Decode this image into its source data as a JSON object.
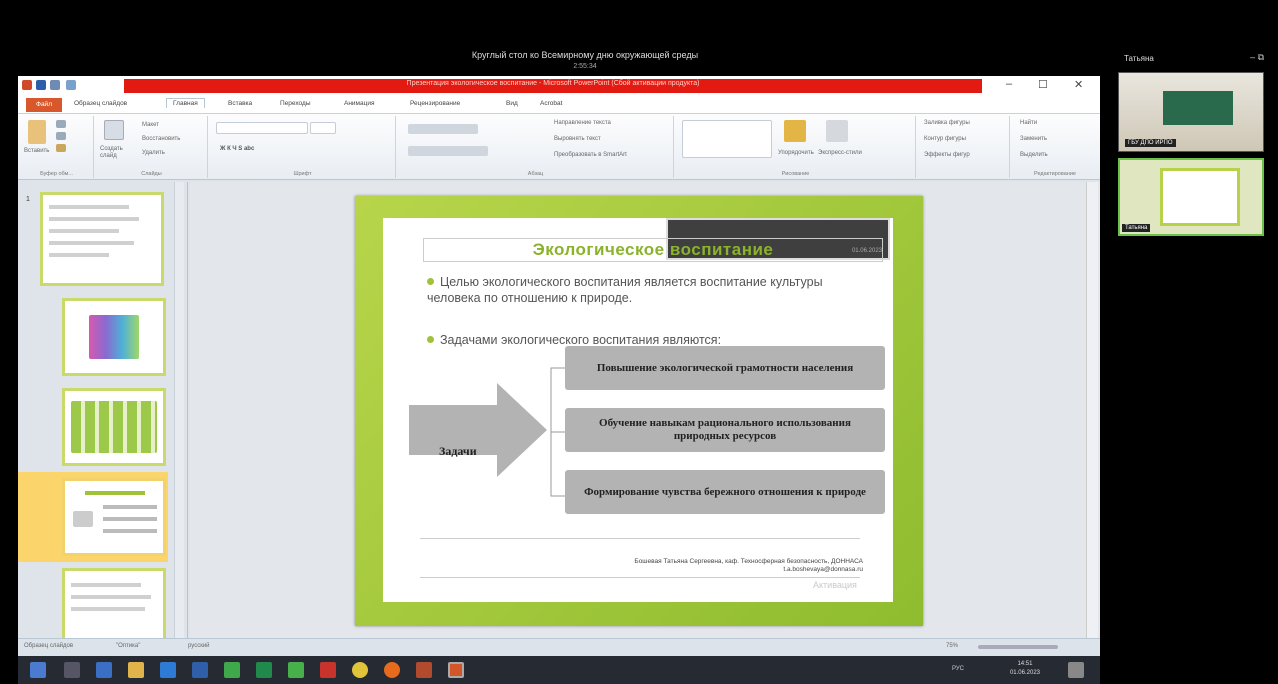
{
  "meeting": {
    "title": "Круглый стол ко Всемирному дню окружающей среды",
    "timer": "2:55:34"
  },
  "window": {
    "title": "Презентация экологическое воспитание - Microsoft PowerPoint (Сбой активации продукта)"
  },
  "tabs": [
    "Файл",
    "Образец слайдов",
    "Главная",
    "Вставка",
    "Переходы",
    "Анимация",
    "Рецензирование",
    "Вид",
    "Acrobat"
  ],
  "ribbon": {
    "groups": [
      "Буфер обм...",
      "Слайды",
      "Шрифт",
      "Абзац",
      "Рисование",
      "Редактирование"
    ],
    "buttons": {
      "paste": "Вставить",
      "new_slide": "Создать слайд",
      "layout": "Макет",
      "reset": "Восстановить",
      "delete": "Удалить",
      "text_dir": "Направление текста",
      "align": "Выровнять текст",
      "smartart": "Преобразовать в SmartArt",
      "arrange": "Упорядочить",
      "styles": "Экспресс-стили",
      "fill": "Заливка фигуры",
      "outline": "Контур фигуры",
      "effects": "Эффекты фигур",
      "find": "Найти",
      "replace": "Заменить",
      "select": "Выделить"
    }
  },
  "slides_panel": {
    "first_number": "1"
  },
  "slide": {
    "overlay_date": "01.06.2023",
    "title": "Экологическое воспитание",
    "bullet1": "Целью экологического воспитания является воспитание культуры человека по отношению к природе.",
    "bullet2": "Задачами экологического воспитания являются:",
    "tasks_label": "Задачи",
    "tasks": [
      "Повышение экологической грамотности населения",
      "Обучение навыкам рационального использования природных ресурсов",
      "Формирование чувства бережного отношения к природе"
    ],
    "footer_line1": "Бошевая Татьяна Сергеевна, каф. Техносферная безопасность, ДОННАСА",
    "footer_line2": "t.a.boshevaya@donnasa.ru",
    "watermark": "Активация"
  },
  "status": {
    "view": "Образец слайдов",
    "theme": "\"Оптика\"",
    "lang": "русский",
    "zoom": "75%"
  },
  "tray": {
    "lang": "РУС",
    "time": "14:51",
    "date": "01.06.2023"
  },
  "participants": {
    "panel_name": "Татьяна",
    "video1_label": "ГБУ ДПО ИРПО",
    "video2_label": "Татьяна"
  }
}
